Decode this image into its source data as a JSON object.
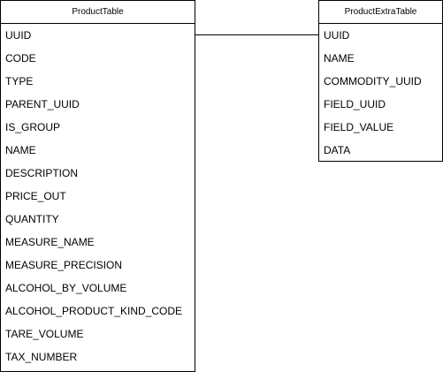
{
  "product_table": {
    "title": "ProductTable",
    "fields": [
      "UUID",
      "CODE",
      "TYPE",
      "PARENT_UUID",
      "IS_GROUP",
      "NAME",
      "DESCRIPTION",
      "PRICE_OUT",
      "QUANTITY",
      "MEASURE_NAME",
      "MEASURE_PRECISION",
      "ALCOHOL_BY_VOLUME",
      "ALCOHOL_PRODUCT_KIND_CODE",
      "TARE_VOLUME",
      "TAX_NUMBER"
    ]
  },
  "product_extra_table": {
    "title": "ProductExtraTable",
    "fields": [
      "UUID",
      "NAME",
      "COMMODITY_UUID",
      "FIELD_UUID",
      "FIELD_VALUE",
      "DATA"
    ]
  },
  "relationships": [
    {
      "from": "ProductTable",
      "from_field": "UUID",
      "to": "ProductExtraTable",
      "to_field": "UUID"
    }
  ]
}
